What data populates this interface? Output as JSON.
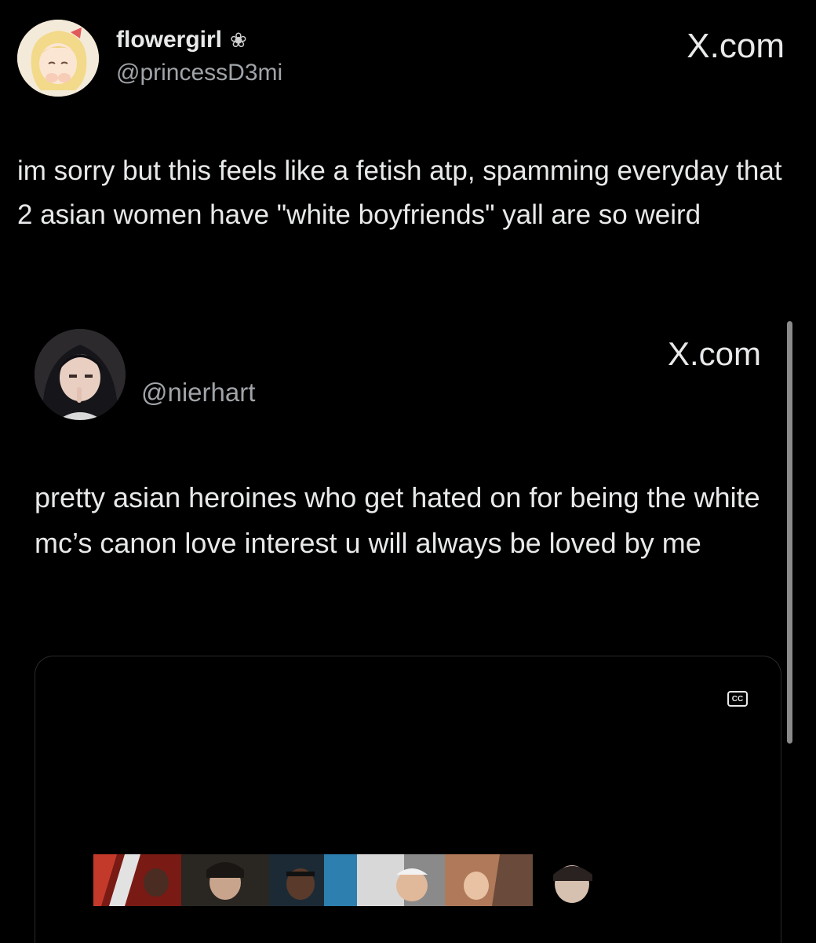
{
  "outer_tweet": {
    "display_name": "flowergirl",
    "name_icon": "flower-icon",
    "name_glyph": "❀",
    "handle": "@princessD3mi",
    "brand": "X.com",
    "text": "im sorry but this feels like a fetish atp, spamming everyday that 2 asian women have \"white boyfriends\" yall are so weird"
  },
  "quoted_tweet": {
    "handle": "@nierhart",
    "brand": "X.com",
    "text": "pretty asian heroines who get hated on for being the white mc’s canon love interest u will always be loved by me",
    "media": {
      "cc_label": "CC",
      "icon": "closed-captions-icon"
    }
  },
  "colors": {
    "background": "#000000",
    "primary_text": "#e7e9ea",
    "secondary_text": "#a0a4a8"
  }
}
